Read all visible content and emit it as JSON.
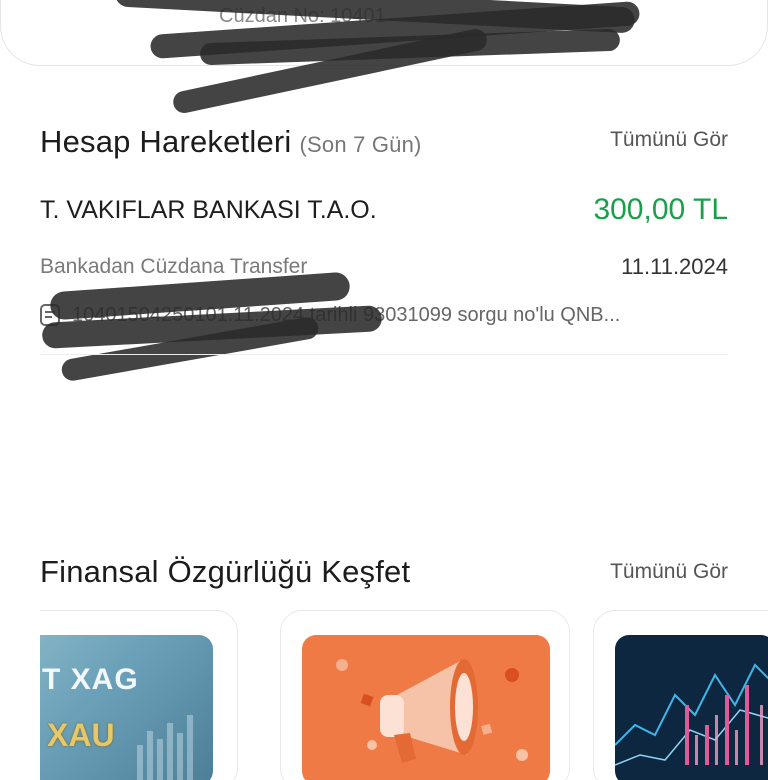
{
  "wallet": {
    "number_label": "Cüzdan No: 10401"
  },
  "transactions": {
    "title": "Hesap Hareketleri",
    "subtitle": "(Son 7 Gün)",
    "see_all": "Tümünü Gör",
    "items": [
      {
        "bank": "T. VAKIFLAR BANKASI T.A.O.",
        "amount": "300,00 TL",
        "type": "Bankadan Cüzdana Transfer",
        "date": "11.11.2024",
        "note": "10401504250101.11.2024 tarihli 93031099 sorgu no'lu QNB..."
      }
    ]
  },
  "discover": {
    "title": "Finansal Özgürlüğü Keşfet",
    "see_all": "Tümünü Gör",
    "cards": [
      {
        "image_text_1": "PT  XAG",
        "image_text_2": "XAU"
      },
      {
        "image_icon": "megaphone-icon"
      },
      {
        "image_icon": "chart-icon"
      }
    ]
  },
  "colors": {
    "amount_positive": "#1aa04b",
    "promo_orange": "#ef7a45"
  }
}
